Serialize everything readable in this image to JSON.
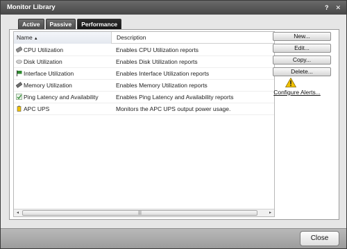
{
  "window": {
    "title": "Monitor Library",
    "help_label": "?",
    "close_label": "✕"
  },
  "tabs": [
    {
      "label": "Active"
    },
    {
      "label": "Passive"
    },
    {
      "label": "Performance",
      "selected": true
    }
  ],
  "table": {
    "columns": {
      "name": "Name",
      "description": "Description",
      "sorted_column": "name",
      "sort": "ascending",
      "sort_arrow": "▲"
    },
    "rows": [
      {
        "icon": "cpu-icon",
        "name": "CPU Utilization",
        "description": "Enables CPU Utilization reports"
      },
      {
        "icon": "disk-icon",
        "name": "Disk Utilization",
        "description": "Enables Disk Utilization reports"
      },
      {
        "icon": "interface-flag-icon",
        "name": "Interface Utilization",
        "description": "Enables Interface Utilization reports"
      },
      {
        "icon": "memory-icon",
        "name": "Memory Utilization",
        "description": "Enables Memory Utilization reports"
      },
      {
        "icon": "ping-icon",
        "name": "Ping Latency and Availability",
        "description": "Enables Ping Latency and Availability reports"
      },
      {
        "icon": "battery-icon",
        "name": "APC UPS",
        "description": "Monitors the APC UPS output power usage."
      }
    ],
    "scrollbar": {
      "left_arrow": "◂",
      "right_arrow": "▸",
      "grip": "|||"
    }
  },
  "actions": {
    "new_label": "New...",
    "edit_label": "Edit...",
    "copy_label": "Copy...",
    "delete_label": "Delete...",
    "configure_alerts_label": "Configure Alerts...",
    "warning_icon": "warning-icon"
  },
  "footer": {
    "close_label": "Close"
  },
  "colors": {
    "titlebar": "#474747",
    "selected_tab": "#151515",
    "warning": "#f2c200"
  }
}
